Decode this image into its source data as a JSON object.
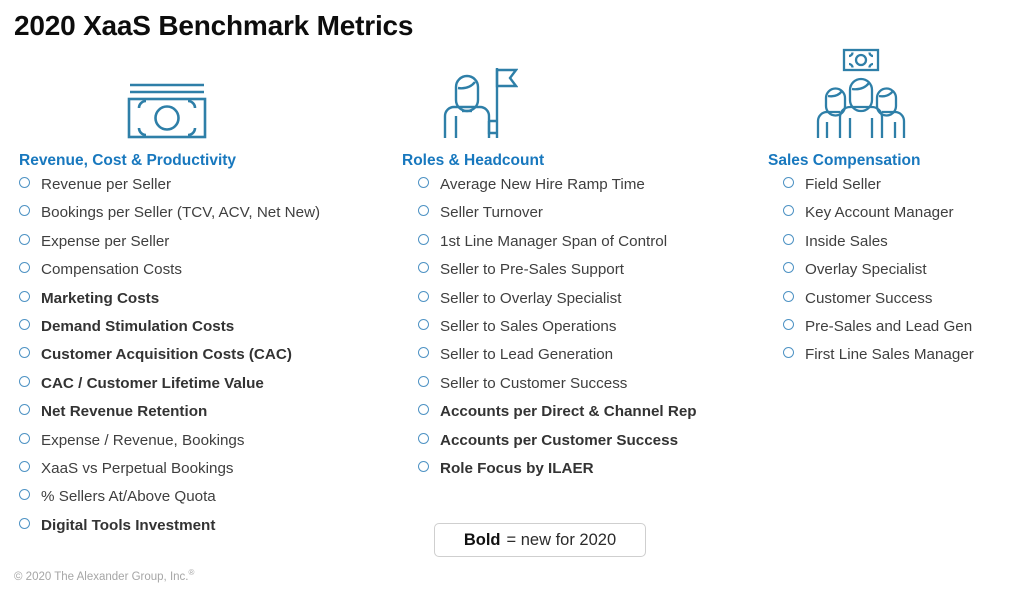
{
  "title": "2020 XaaS Benchmark Metrics",
  "theme": {
    "heading_blue": "#1878be",
    "icon_blue": "#2e7fa8",
    "bullet_blue": "#4f93c4",
    "body_text": "#3f3f3f",
    "bold_text": "#333333",
    "title_text": "#0d0d0d",
    "footer_text": "#a6a6a6",
    "legend_border": "#cfcfcf",
    "background": "#ffffff"
  },
  "columns": [
    {
      "id": "revenue-cost-productivity",
      "icon": "banknote-icon",
      "heading": "Revenue, Cost & Productivity",
      "items": [
        {
          "label": "Revenue per Seller",
          "bold": false
        },
        {
          "label": "Bookings per Seller (TCV, ACV, Net New)",
          "bold": false
        },
        {
          "label": "Expense per Seller",
          "bold": false
        },
        {
          "label": "Compensation Costs",
          "bold": false
        },
        {
          "label": "Marketing Costs",
          "bold": true
        },
        {
          "label": "Demand Stimulation Costs",
          "bold": true
        },
        {
          "label": "Customer Acquisition Costs (CAC)",
          "bold": true
        },
        {
          "label": "CAC / Customer Lifetime Value",
          "bold": true
        },
        {
          "label": "Net Revenue Retention",
          "bold": true
        },
        {
          "label": "Expense / Revenue, Bookings",
          "bold": false
        },
        {
          "label": "XaaS vs Perpetual Bookings",
          "bold": false
        },
        {
          "label": "% Sellers At/Above Quota",
          "bold": false
        },
        {
          "label": "Digital Tools Investment",
          "bold": true
        }
      ]
    },
    {
      "id": "roles-headcount",
      "icon": "person-with-flag-icon",
      "heading": "Roles & Headcount",
      "items": [
        {
          "label": "Average New Hire Ramp Time",
          "bold": false
        },
        {
          "label": "Seller Turnover",
          "bold": false
        },
        {
          "label": "1st Line Manager Span of Control",
          "bold": false
        },
        {
          "label": "Seller to Pre-Sales Support",
          "bold": false
        },
        {
          "label": "Seller to Overlay Specialist",
          "bold": false
        },
        {
          "label": "Seller to Sales Operations",
          "bold": false
        },
        {
          "label": "Seller to Lead Generation",
          "bold": false
        },
        {
          "label": "Seller to Customer Success",
          "bold": false
        },
        {
          "label": "Accounts per Direct & Channel Rep",
          "bold": true
        },
        {
          "label": "Accounts per Customer Success",
          "bold": true
        },
        {
          "label": "Role Focus by ILAER",
          "bold": true
        }
      ]
    },
    {
      "id": "sales-compensation",
      "icon": "team-with-money-icon",
      "heading": "Sales Compensation",
      "items": [
        {
          "label": "Field Seller",
          "bold": false
        },
        {
          "label": "Key Account Manager",
          "bold": false
        },
        {
          "label": "Inside Sales",
          "bold": false
        },
        {
          "label": "Overlay Specialist",
          "bold": false
        },
        {
          "label": "Customer Success",
          "bold": false
        },
        {
          "label": "Pre-Sales and Lead Gen",
          "bold": false
        },
        {
          "label": "First Line Sales Manager",
          "bold": false
        }
      ]
    }
  ],
  "legend": {
    "strong": "Bold",
    "rest": "= new for 2020"
  },
  "footer": {
    "copyright": "© 2020 The Alexander Group, Inc.",
    "registered_mark": "®"
  }
}
